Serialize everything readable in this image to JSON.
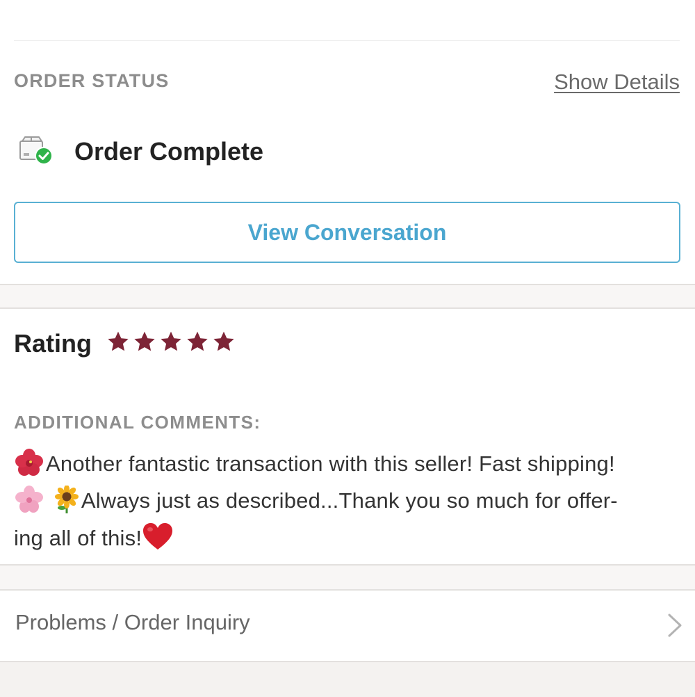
{
  "order_status": {
    "label": "ORDER STATUS",
    "show_details": "Show Details",
    "status_text": "Order Complete",
    "view_conversation": "View Conversation"
  },
  "rating": {
    "label": "Rating",
    "stars": 5,
    "max_stars": 5,
    "star_color": "#7d2436"
  },
  "comments": {
    "label": "ADDITIONAL COMMENTS:",
    "line1": "Another fantastic transaction with this seller! Fast shipping!",
    "line2": "Always just as described...Thank you so much for offer-",
    "line3": "ing all of this!",
    "emojis": [
      "hibiscus-emoji",
      "cherry-blossom-emoji",
      "sunflower-emoji",
      "red-heart-emoji"
    ]
  },
  "problems": {
    "label": "Problems / Order Inquiry"
  },
  "colors": {
    "accent": "#4aa6cf",
    "success": "#2fb34a",
    "muted": "#8d8d8d"
  }
}
